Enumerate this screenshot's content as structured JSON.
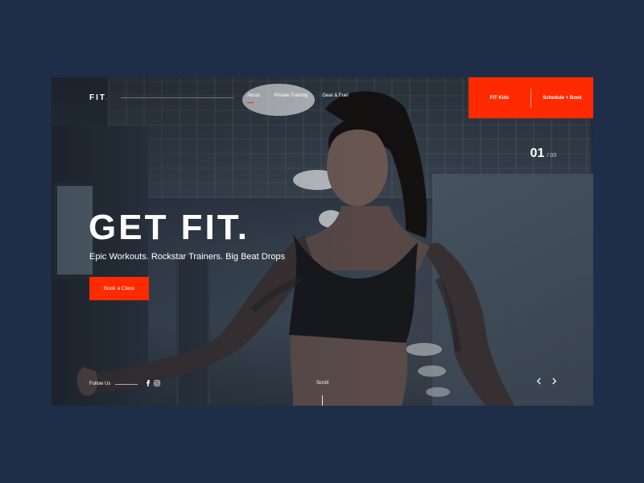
{
  "brand": {
    "logo_text": "FIT",
    "logo_dot": ".",
    "accent": "#ff2a00"
  },
  "nav": {
    "items": [
      {
        "label": "About",
        "active": true
      },
      {
        "label": "Private Training",
        "active": false
      },
      {
        "label": "Gear & Fuel",
        "active": false
      }
    ]
  },
  "cta_bar": {
    "links": [
      {
        "label": "FIT Kids"
      },
      {
        "label": "Schedule + Book"
      }
    ]
  },
  "slider": {
    "current": "01",
    "total": "/ 03"
  },
  "hero": {
    "headline": "GET FIT.",
    "subline": "Epic Workouts. Rockstar Trainers. Big Beat Drops",
    "cta_label": "Book a Class"
  },
  "footer": {
    "follow_label": "Follow Us",
    "social_icons": [
      "facebook-icon",
      "instagram-icon"
    ],
    "scroll_label": "Scroll",
    "prev_icon": "chevron-left-icon",
    "next_icon": "chevron-right-icon"
  }
}
